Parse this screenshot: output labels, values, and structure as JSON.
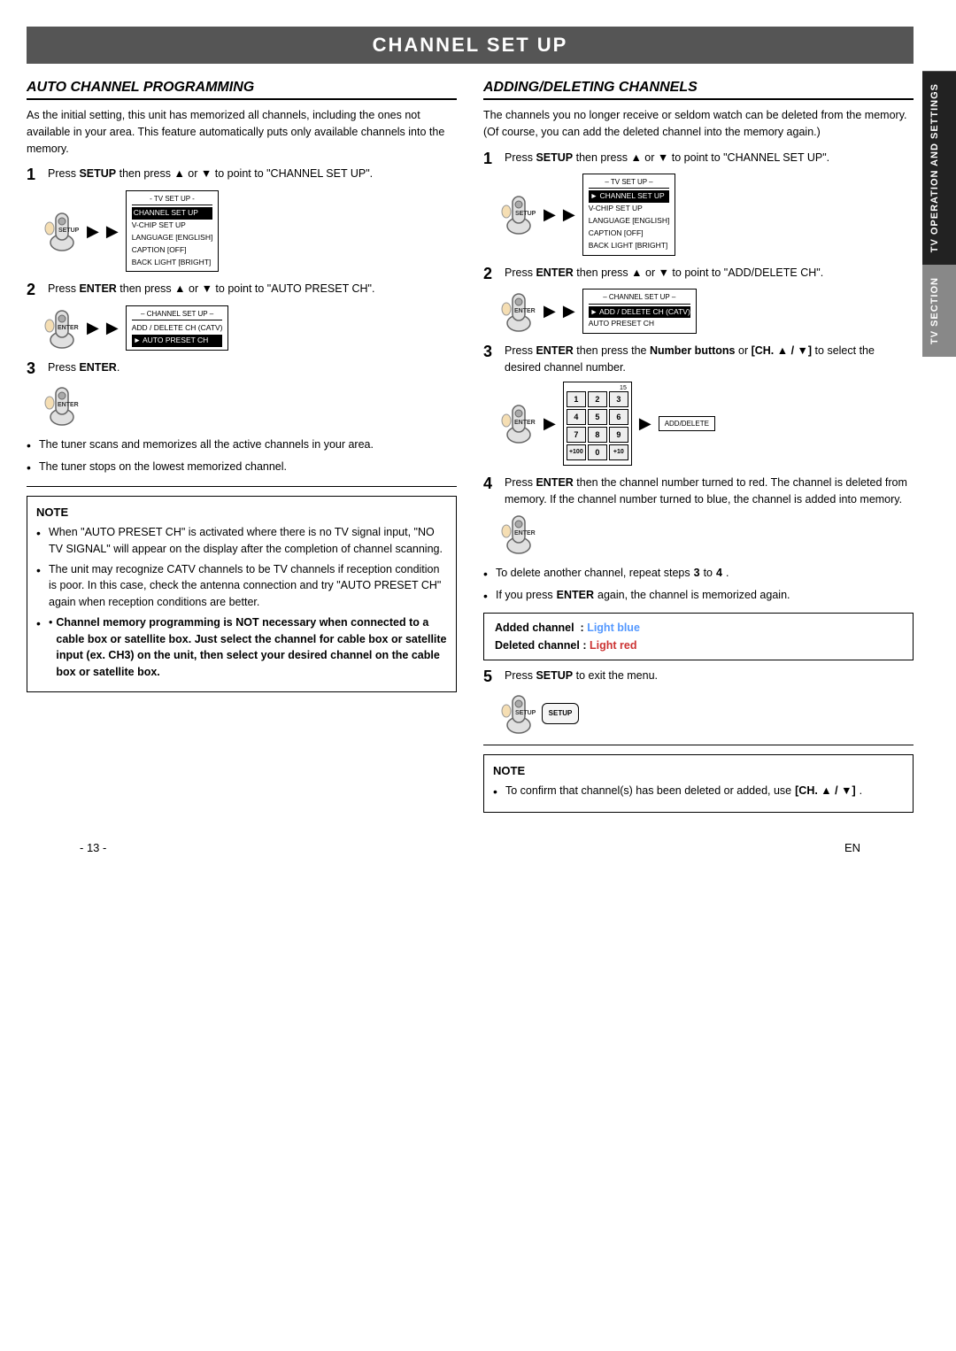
{
  "page": {
    "title": "CHANNEL SET UP",
    "footer_page": "- 13 -",
    "footer_lang": "EN"
  },
  "left_section": {
    "title": "AUTO CHANNEL PROGRAMMING",
    "intro": "As the initial setting, this unit has memorized all channels, including the ones not available in your area. This feature automatically puts only available channels into the memory.",
    "step1_label": "1",
    "step1_text": "Press SETUP then press ▲ or ▼ to point to \"CHANNEL SET UP\".",
    "step2_label": "2",
    "step2_text": "Press ENTER then press ▲ or ▼ to point to \"AUTO PRESET CH\".",
    "step3_label": "3",
    "step3_text": "Press ENTER.",
    "bullet1": "The tuner scans and memorizes all the active channels in your area.",
    "bullet2": "The tuner stops on the lowest memorized channel.",
    "note_title": "NOTE",
    "note_bullets": [
      "When \"AUTO PRESET CH\" is activated where there is no TV signal input, \"NO TV SIGNAL\" will appear on the display after the completion of channel scanning.",
      "The unit may recognize CATV channels to be TV channels if reception condition is poor. In this case, check the antenna connection and try \"AUTO PRESET CH\" again when reception conditions are better.",
      "Channel memory programming is NOT necessary when connected to a cable box or satellite box. Just select the channel for cable box or satellite input (ex. CH3) on the unit, then select your desired channel on the cable box or satellite box."
    ],
    "menu_tv_set_up": "- TV SET UP -",
    "menu_channel_set_up": "CHANNEL SET UP",
    "menu_v_chip_set_up": "V-CHIP SET UP",
    "menu_language": "LANGUAGE  [ENGLISH]",
    "menu_caption": "CAPTION    [OFF]",
    "menu_back_light": "BACK LIGHT [BRIGHT]",
    "menu2_channel_set_up": "– CHANNEL SET UP –",
    "menu2_add_delete": "ADD / DELETE CH (CATV)",
    "menu2_auto_preset": "► AUTO PRESET CH"
  },
  "right_section": {
    "title": "ADDING/DELETING CHANNELS",
    "intro": "The channels you no longer receive or seldom watch can be deleted from the memory. (Of course, you can add the deleted channel into the memory again.)",
    "step1_label": "1",
    "step1_text": "Press SETUP then press ▲ or ▼ to point to \"CHANNEL SET UP\".",
    "step2_label": "2",
    "step2_text": "Press ENTER then press ▲ or ▼ to point to \"ADD/DELETE CH\".",
    "step3_label": "3",
    "step3_text": "Press ENTER then press the Number buttons or [CH. ▲ / ▼] to select the desired channel number.",
    "step4_label": "4",
    "step4_text": "Press ENTER then the channel number turned to red. The channel is deleted from memory. If the channel number turned to blue, the channel is added into memory.",
    "step5_label": "5",
    "step5_text": "Press SETUP to exit the menu.",
    "bullet_delete": "To delete another channel, repeat steps 3 to 4.",
    "bullet_enter": "If you press ENTER again, the channel is memorized again.",
    "info_added": "Added channel  :  Light blue",
    "info_deleted": "Deleted channel :  Light red",
    "note_title": "NOTE",
    "note_bullet": "To confirm that channel(s) has been deleted or added, use [CH. ▲ / ▼].",
    "menu_r1_tv_set_up": "– TV SET UP –",
    "menu_r1_channel_set_up": "► CHANNEL SET UP",
    "menu_r1_v_chip": "V-CHIP SET UP",
    "menu_r1_language": "LANGUAGE  [ENGLISH]",
    "menu_r1_caption": "CAPTION    [OFF]",
    "menu_r1_back_light": "BACK LIGHT [BRIGHT]",
    "menu_r2_channel_set_up": "– CHANNEL SET UP –",
    "menu_r2_add_delete": "► ADD / DELETE CH (CATV)",
    "menu_r2_auto_preset": "AUTO PRESET CH",
    "numpad_15": "15",
    "numpad_add_delete": "ADD/DELETE"
  },
  "side_tabs": {
    "tab1": "TV OPERATION AND SETTINGS",
    "tab2": "TV SECTION"
  }
}
